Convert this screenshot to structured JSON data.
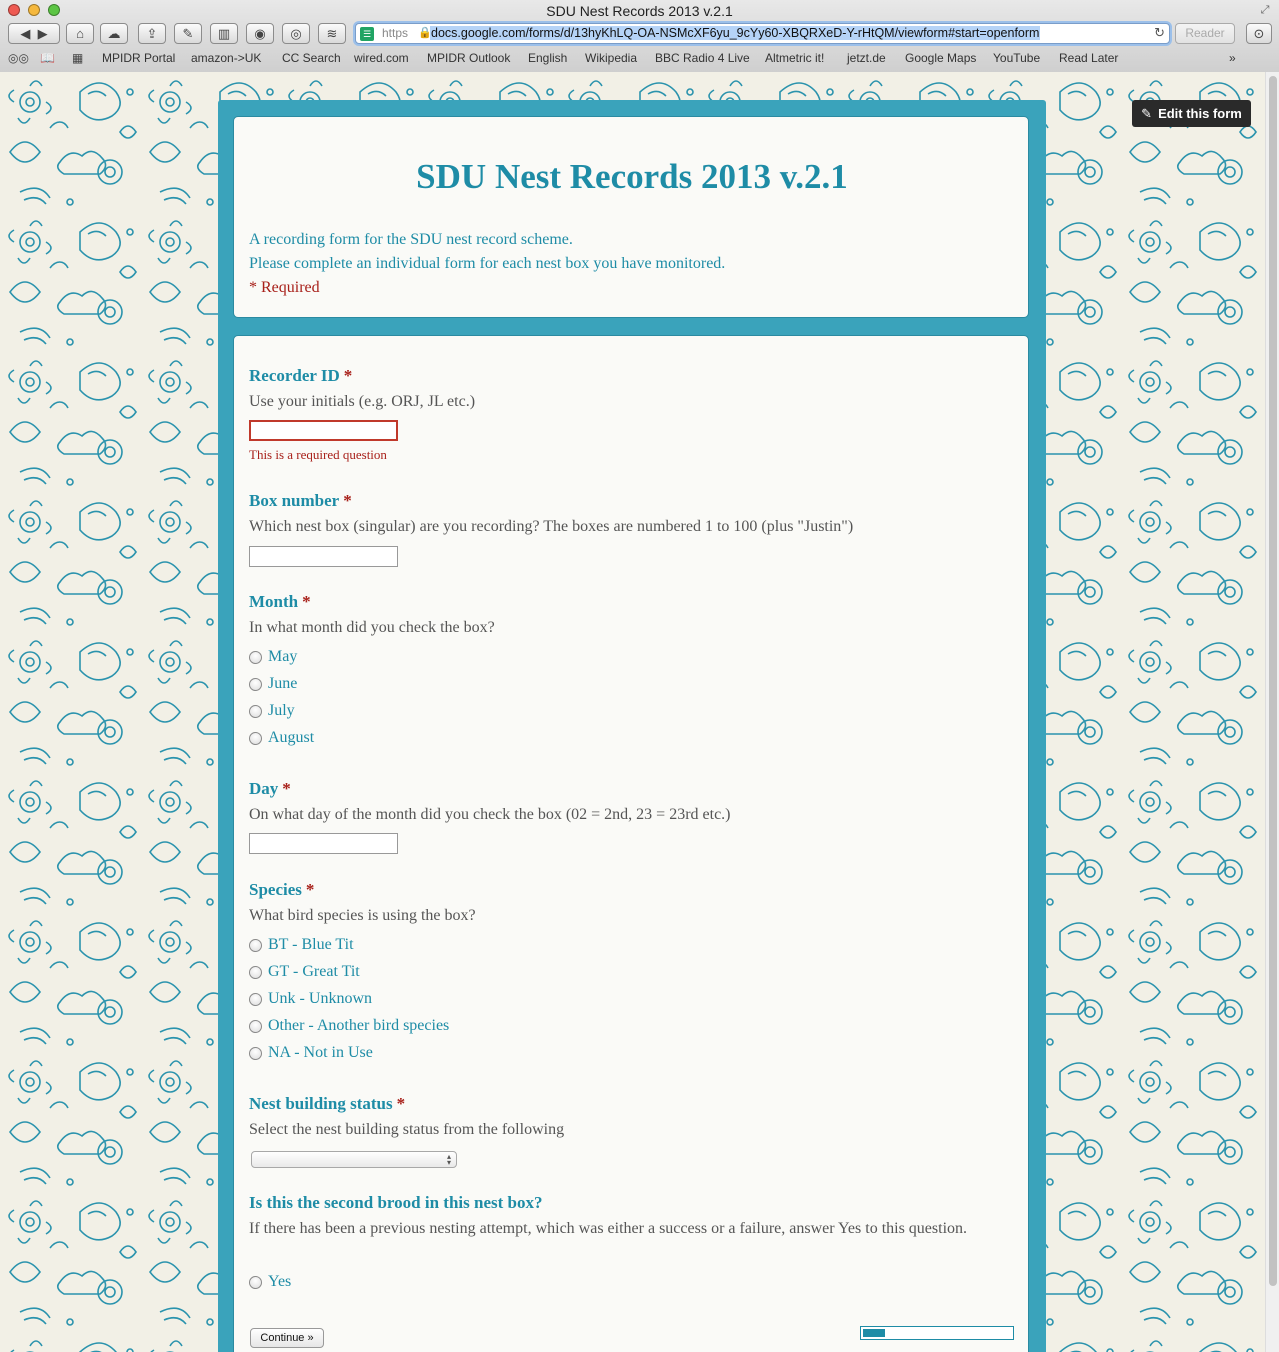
{
  "window": {
    "title": "SDU Nest Records 2013 v.2.1"
  },
  "toolbar": {
    "url_scheme": "https",
    "url": "docs.google.com/forms/d/13hyKhLQ-OA-NSMcXF6yu_9cYy60-XBQRXeD-Y-rHtQM/viewform#start=openform",
    "reader_label": "Reader"
  },
  "bookmarks": [
    "MPIDR Portal",
    "amazon->UK",
    "CC Search",
    "wired.com",
    "MPIDR Outlook",
    "English",
    "Wikipedia",
    "BBC Radio 4 Live",
    "Altmetric it!",
    "jetzt.de",
    "Google Maps",
    "YouTube",
    "Read Later"
  ],
  "edit_button": {
    "label": "Edit this form"
  },
  "form": {
    "title": "SDU Nest Records 2013 v.2.1",
    "description_line1": "A recording form for the SDU nest record scheme.",
    "description_line2": "Please complete an individual form for each nest box you have monitored.",
    "required_note": "* Required",
    "questions": [
      {
        "title": "Recorder ID",
        "required": true,
        "help": "Use your initials (e.g. ORJ, JL etc.)",
        "error": "This is a required question"
      },
      {
        "title": "Box number",
        "required": true,
        "help": "Which nest box (singular) are you recording? The boxes are numbered 1 to 100 (plus \"Justin\")"
      },
      {
        "title": "Month",
        "required": true,
        "help": "In what month did you check the box?",
        "options": [
          "May",
          "June",
          "July",
          "August"
        ]
      },
      {
        "title": "Day",
        "required": true,
        "help": "On what day of the month did you check the box (02 = 2nd, 23 = 23rd etc.)"
      },
      {
        "title": "Species",
        "required": true,
        "help": "What bird species is using the box?",
        "options": [
          "BT - Blue Tit",
          "GT - Great Tit",
          "Unk - Unknown",
          "Other - Another bird species",
          "NA - Not in Use"
        ]
      },
      {
        "title": "Nest building status",
        "required": true,
        "help": "Select the nest building status from the following",
        "selected": ""
      },
      {
        "title": "Is this the second brood in this nest box?",
        "required": false,
        "help": "If there has been a previous nesting attempt, which was either a success or a failure, answer Yes to this question.",
        "options": [
          "Yes"
        ]
      }
    ],
    "continue_label": "Continue »",
    "required_marker": "*",
    "progress": 0.15
  },
  "colors": {
    "accent": "#1e8ca6",
    "frame": "#3aa3bb",
    "error": "#a8201a"
  }
}
